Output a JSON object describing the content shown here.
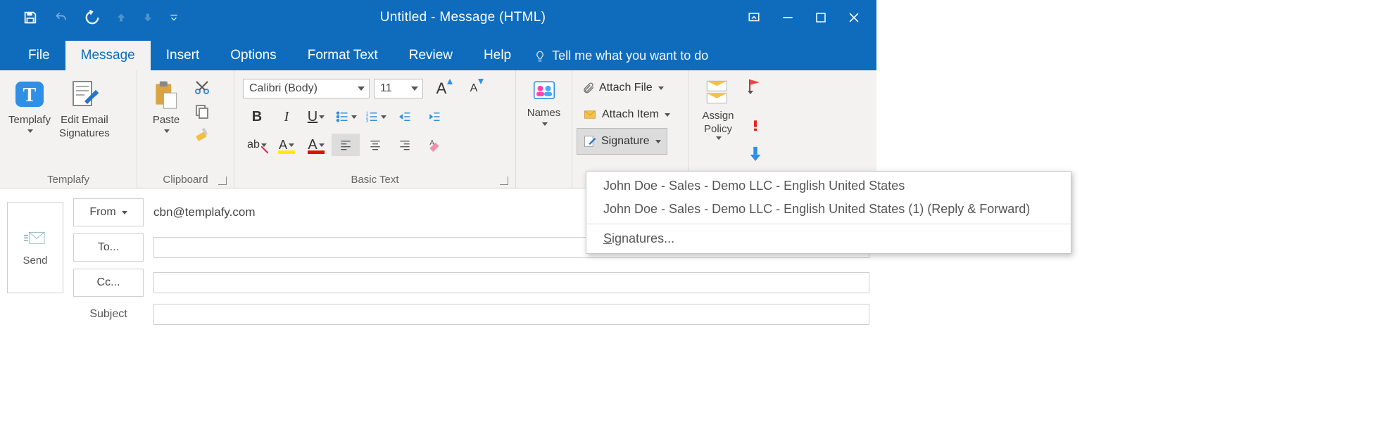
{
  "window": {
    "title": "Untitled  -  Message (HTML)"
  },
  "tabs": {
    "file": "File",
    "message": "Message",
    "insert": "Insert",
    "options": "Options",
    "format_text": "Format Text",
    "review": "Review",
    "help": "Help",
    "tell_me": "Tell me what you want to do"
  },
  "ribbon": {
    "templafy": {
      "label": "Templafy",
      "templafy_btn": "Templafy",
      "edit_sig": "Edit Email\nSignatures"
    },
    "clipboard": {
      "label": "Clipboard",
      "paste": "Paste"
    },
    "basic_text": {
      "label": "Basic Text",
      "font_name": "Calibri (Body)",
      "font_size": "11"
    },
    "names": {
      "label": "Names"
    },
    "include": {
      "attach_file": "Attach File",
      "attach_item": "Attach Item",
      "signature": "Signature"
    },
    "tags": {
      "assign_policy": "Assign\nPolicy"
    }
  },
  "signature_menu": {
    "item1": "John Doe - Sales - Demo LLC - English United States",
    "item2": "John Doe - Sales - Demo LLC - English United States (1) (Reply & Forward)",
    "signatures": "Signatures..."
  },
  "compose": {
    "send": "Send",
    "from_label": "From",
    "from_value": "cbn@templafy.com",
    "to_label": "To...",
    "cc_label": "Cc...",
    "subject_label": "Subject"
  }
}
